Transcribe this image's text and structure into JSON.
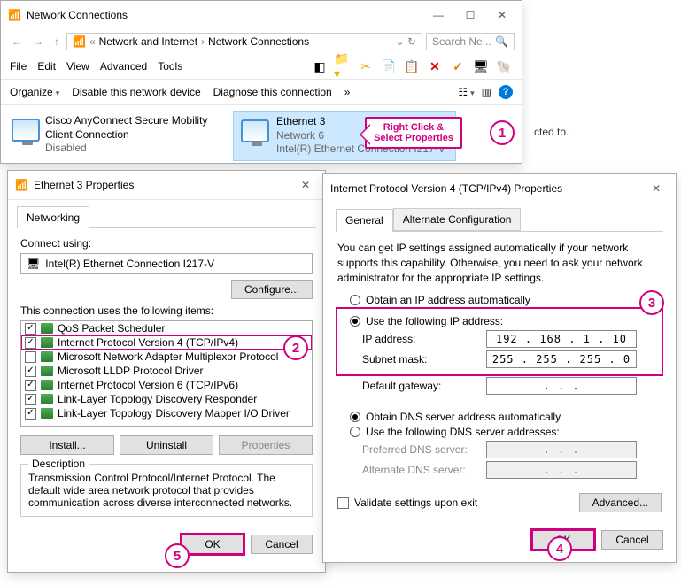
{
  "main": {
    "title": "Network Connections",
    "crumbs": {
      "a": "Network and Internet",
      "b": "Network Connections",
      "pre": "«"
    },
    "search_placeholder": "Search Ne...",
    "menu": {
      "file": "File",
      "edit": "Edit",
      "view": "View",
      "advanced": "Advanced",
      "tools": "Tools"
    },
    "cmd": {
      "organize": "Organize",
      "disable": "Disable this network device",
      "diagnose": "Diagnose this connection",
      "chev": "»"
    },
    "conn1": {
      "name": "Cisco AnyConnect Secure Mobility Client Connection",
      "status": "Disabled"
    },
    "conn2": {
      "name": "Ethernet 3",
      "net": "Network  6",
      "hw": "Intel(R) Ethernet Connection I217-V"
    }
  },
  "callout": "Right Click & Select Properties",
  "side": "cted to.",
  "steps": {
    "s1": "1",
    "s2": "2",
    "s3": "3",
    "s4": "4",
    "s5": "5"
  },
  "prop": {
    "title": "Ethernet 3 Properties",
    "tab": "Networking",
    "connect_using": "Connect using:",
    "adapter": "Intel(R) Ethernet Connection I217-V",
    "configure": "Configure...",
    "items_label": "This connection uses the following items:",
    "items": [
      {
        "chk": true,
        "label": "QoS Packet Scheduler"
      },
      {
        "chk": true,
        "label": "Internet Protocol Version 4 (TCP/IPv4)",
        "hl": true
      },
      {
        "chk": false,
        "label": "Microsoft Network Adapter Multiplexor Protocol"
      },
      {
        "chk": true,
        "label": "Microsoft LLDP Protocol Driver"
      },
      {
        "chk": true,
        "label": "Internet Protocol Version 6 (TCP/IPv6)"
      },
      {
        "chk": true,
        "label": "Link-Layer Topology Discovery Responder"
      },
      {
        "chk": true,
        "label": "Link-Layer Topology Discovery Mapper I/O Driver"
      }
    ],
    "install": "Install...",
    "uninstall": "Uninstall",
    "properties": "Properties",
    "desc_label": "Description",
    "desc": "Transmission Control Protocol/Internet Protocol. The default wide area network protocol that provides communication across diverse interconnected networks.",
    "ok": "OK",
    "cancel": "Cancel"
  },
  "ip": {
    "title": "Internet Protocol Version 4 (TCP/IPv4) Properties",
    "tab_general": "General",
    "tab_alt": "Alternate Configuration",
    "desc": "You can get IP settings assigned automatically if your network supports this capability. Otherwise, you need to ask your network administrator for the appropriate IP settings.",
    "r_auto_ip": "Obtain an IP address automatically",
    "r_use_ip": "Use the following IP address:",
    "f_ip": "IP address:",
    "v_ip": "192 . 168 .  1  .  10",
    "f_mask": "Subnet mask:",
    "v_mask": "255 . 255 . 255 .  0",
    "f_gw": "Default gateway:",
    "v_gw": ".       .       .",
    "r_auto_dns": "Obtain DNS server address automatically",
    "r_use_dns": "Use the following DNS server addresses:",
    "f_pdns": "Preferred DNS server:",
    "f_adns": "Alternate DNS server:",
    "v_blank": ".       .       .",
    "validate": "Validate settings upon exit",
    "advanced": "Advanced...",
    "ok": "OK",
    "cancel": "Cancel"
  }
}
